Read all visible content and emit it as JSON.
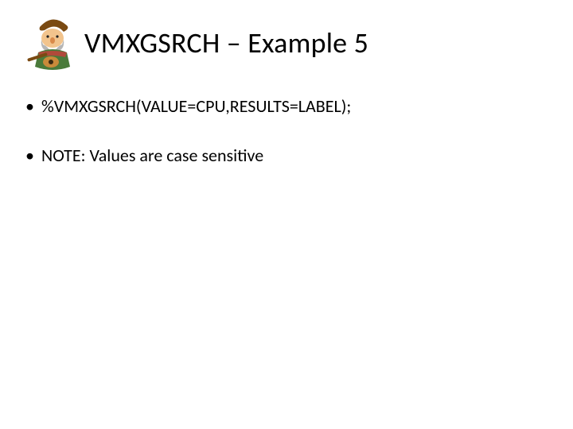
{
  "header": {
    "title": "VMXGSRCH – Example 5",
    "mascot_name": "cartoon-mascot-icon"
  },
  "bullets": [
    "%VMXGSRCH(VALUE=CPU,RESULTS=LABEL);",
    "NOTE: Values are case sensitive"
  ]
}
